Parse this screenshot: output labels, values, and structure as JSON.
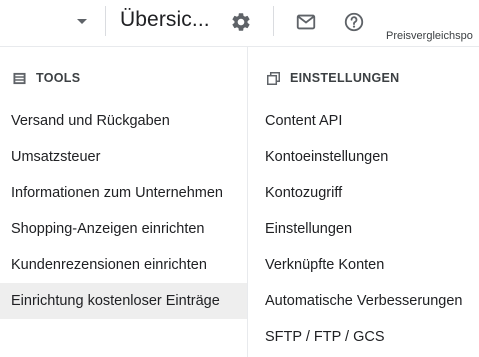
{
  "header": {
    "title": "Übersic...",
    "overflow_label": "Preisvergleichspo"
  },
  "icons": {
    "dropdown": "caret-down-icon",
    "settings": "gear-icon",
    "mail": "mail-icon",
    "help": "help-icon",
    "tools": "tools-icon",
    "settings_section": "settings-stack-icon"
  },
  "tools": {
    "heading": "TOOLS",
    "items": [
      "Versand und Rückgaben",
      "Umsatzsteuer",
      "Informationen zum Unternehmen",
      "Shopping-Anzeigen einrichten",
      "Kundenrezensionen einrichten",
      "Einrichtung kostenloser Einträge"
    ]
  },
  "settings": {
    "heading": "EINSTELLUNGEN",
    "items": [
      "Content API",
      "Kontoeinstellungen",
      "Kontozugriff",
      "Einstellungen",
      "Verknüpfte Konten",
      "Automatische Verbesserungen",
      "SFTP / FTP / GCS"
    ]
  },
  "colors": {
    "text": "#202124",
    "icon": "#5f6368",
    "active_bg": "#eeeeee",
    "divider": "#dadce0"
  }
}
